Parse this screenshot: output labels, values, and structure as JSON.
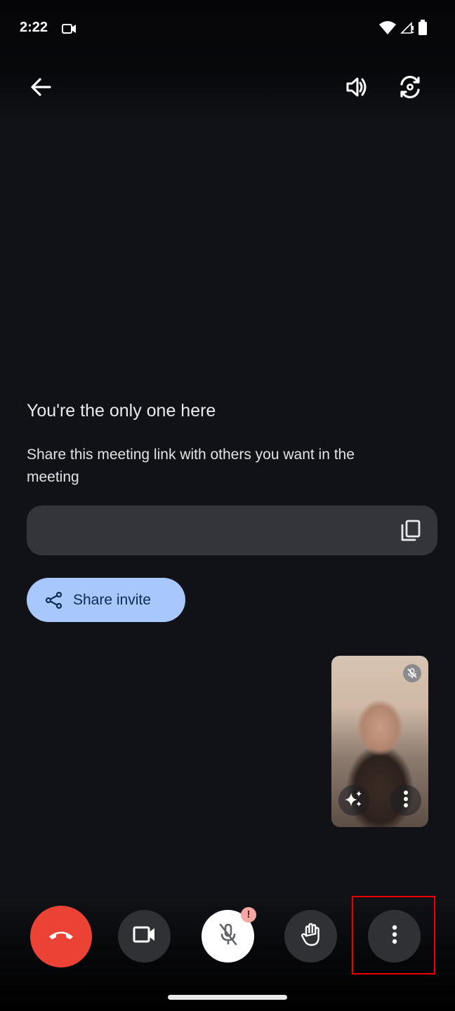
{
  "status_bar": {
    "time": "2:22",
    "icons": [
      "video-recording-icon",
      "wifi-icon",
      "signal-no-service-icon",
      "battery-icon"
    ]
  },
  "top_bar": {
    "back_icon": "arrow-back-icon",
    "speaker_icon": "volume-up-icon",
    "switch_camera_icon": "flip-camera-icon"
  },
  "main": {
    "title": "You're the only one here",
    "description": "Share this meeting link with others you want in the meeting",
    "meeting_link": "",
    "copy_icon": "copy-icon",
    "share_button_label": "Share invite",
    "share_icon": "share-icon"
  },
  "self_view": {
    "muted_icon": "mic-off-icon",
    "effects_icon": "sparkle-effects-icon",
    "more_icon": "more-vert-icon"
  },
  "controls": {
    "buttons": [
      {
        "name": "end-call",
        "icon": "call-end-icon"
      },
      {
        "name": "camera",
        "icon": "videocam-icon"
      },
      {
        "name": "microphone",
        "icon": "mic-off-icon",
        "badge": "!"
      },
      {
        "name": "raise-hand",
        "icon": "hand-icon"
      },
      {
        "name": "more-options",
        "icon": "more-vert-icon",
        "highlighted": true
      }
    ]
  },
  "colors": {
    "background": "#111217",
    "end_call": "#ea4335",
    "share_button": "#a8c7fa",
    "highlight": "#e00000"
  }
}
